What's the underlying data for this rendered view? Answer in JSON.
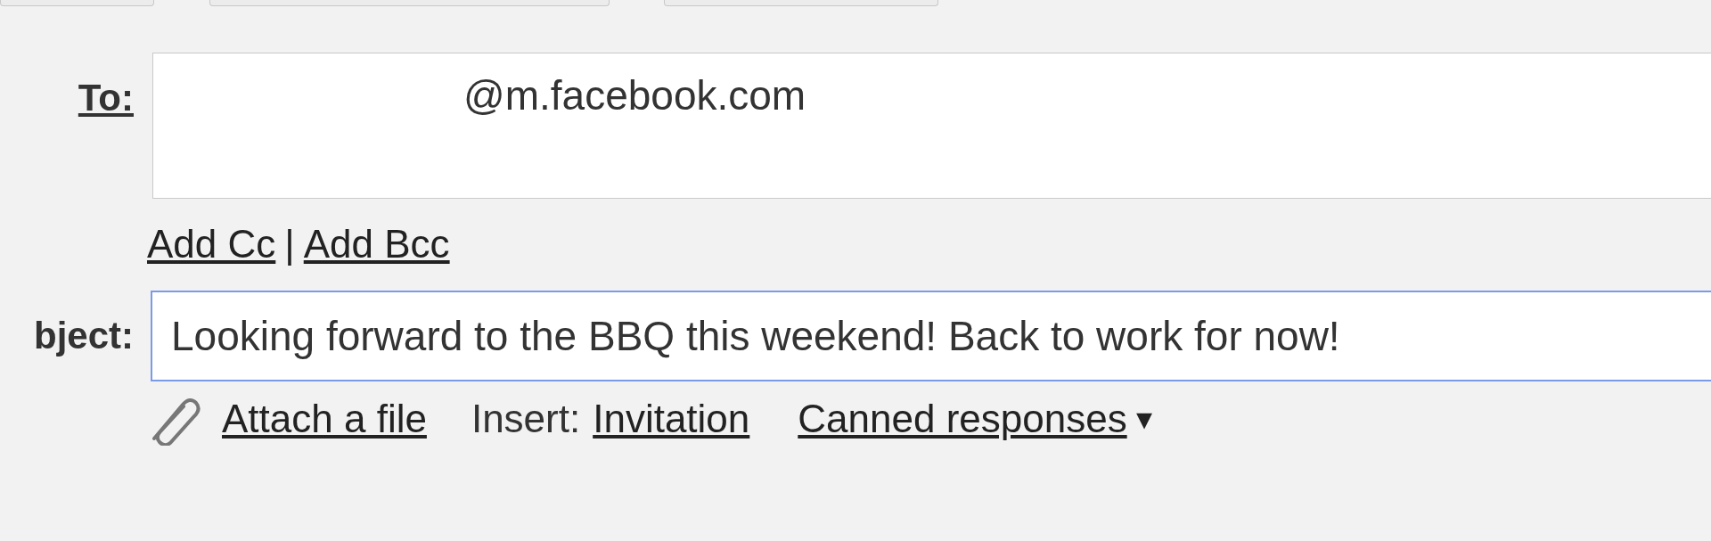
{
  "top_buttons": [
    {
      "kind": "stub"
    },
    {
      "kind": "stub"
    },
    {
      "kind": "stub"
    }
  ],
  "to": {
    "label": "To:",
    "value": "@m.facebook.com"
  },
  "recipient_links": [
    {
      "label": "Add Cc"
    },
    {
      "label": "|",
      "kind": "separator"
    },
    {
      "label": "Add Bcc"
    }
  ],
  "subject": {
    "label": "bject:",
    "value": "Looking forward to the BBQ this weekend! Back to work for now!",
    "focused": true
  },
  "attachments_row": {
    "attach": "Attach a file",
    "insert_label": "Insert:",
    "invitation": "Invitation",
    "canned": "Canned responses",
    "canned_arrow": "▾"
  }
}
